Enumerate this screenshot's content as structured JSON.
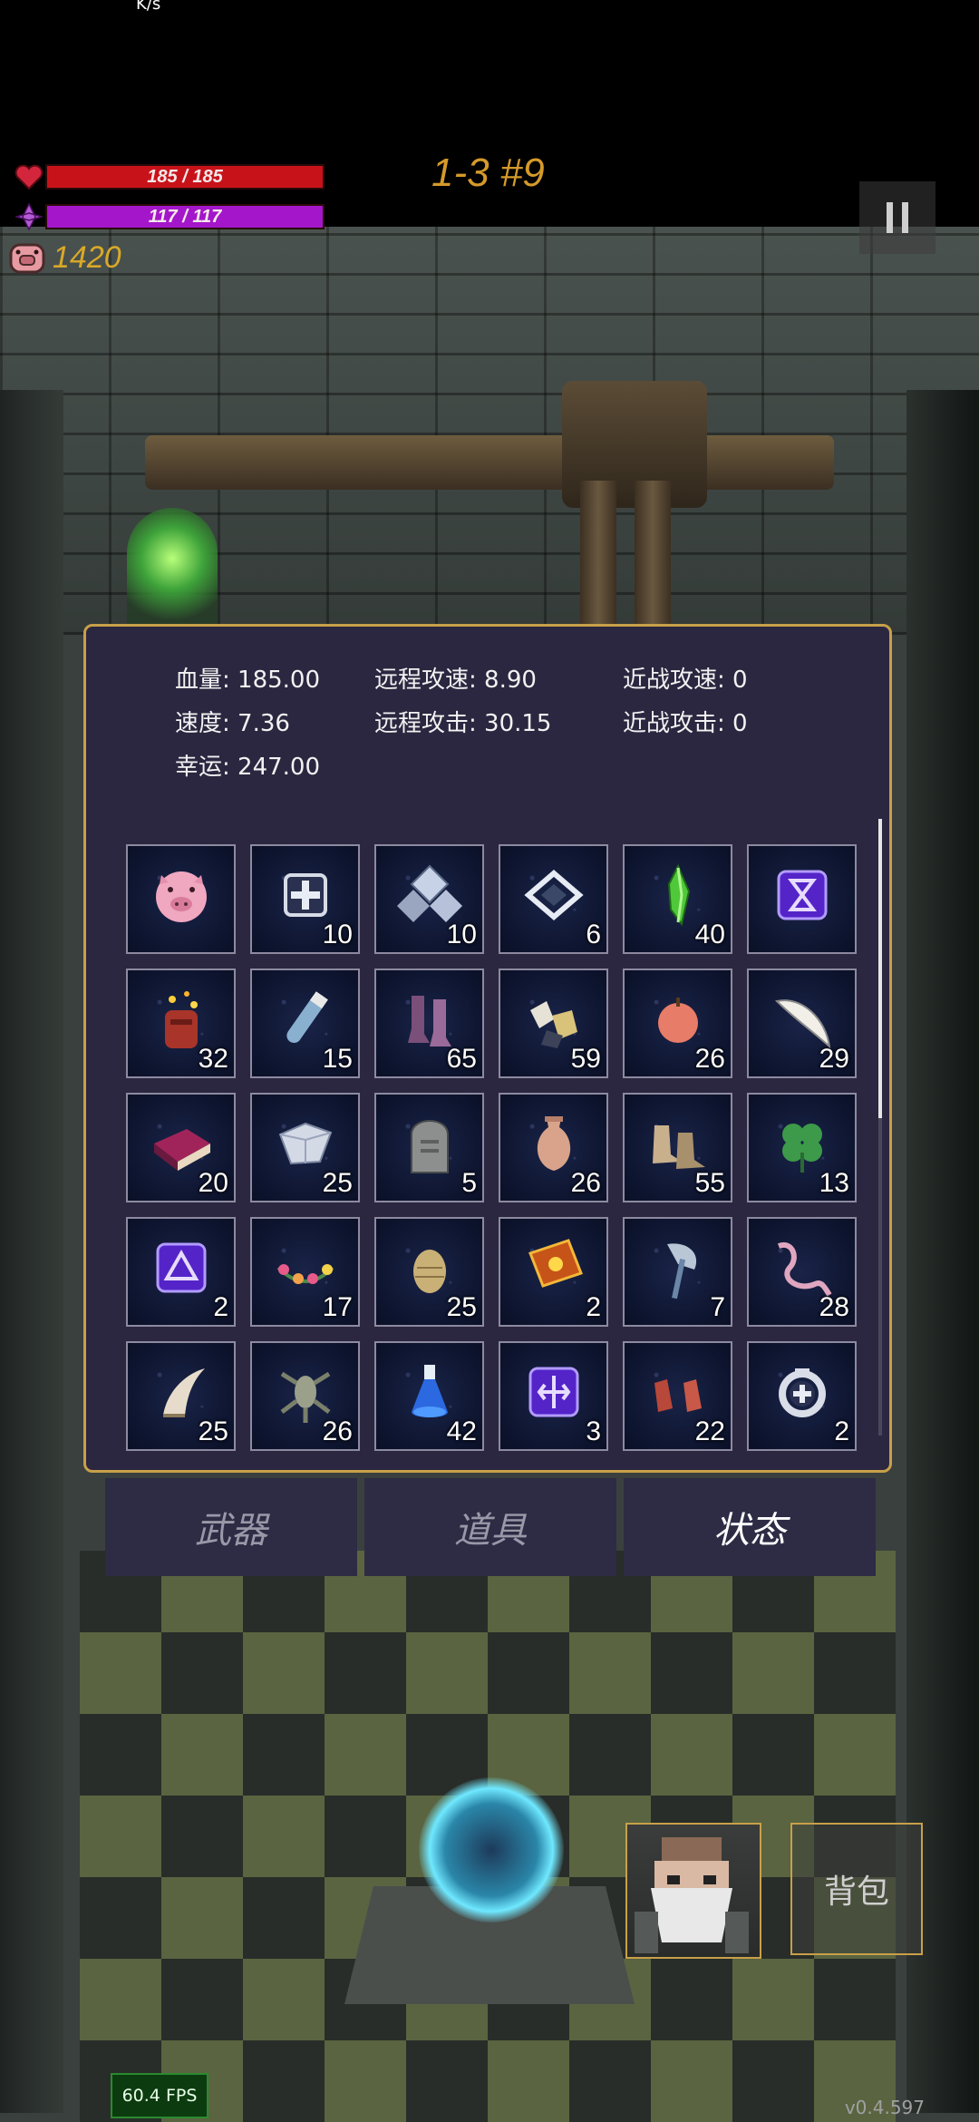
{
  "status_bar": {
    "net_speed": "K/s"
  },
  "hud": {
    "hp": {
      "text": "185 / 185",
      "fill": 1.0,
      "color": "#c8121a"
    },
    "mp": {
      "text": "117 / 117",
      "fill": 1.0,
      "color": "#a316c9"
    },
    "coins": "1420",
    "level": "1-3 #9"
  },
  "stats": {
    "hp": {
      "label": "血量:",
      "value": "185.00"
    },
    "speed": {
      "label": "速度:",
      "value": "7.36"
    },
    "luck": {
      "label": "幸运:",
      "value": "247.00"
    },
    "ranged_speed": {
      "label": "远程攻速:",
      "value": "8.90"
    },
    "ranged_attack": {
      "label": "远程攻击:",
      "value": "30.15"
    },
    "melee_speed": {
      "label": "近战攻速:",
      "value": "0"
    },
    "melee_attack": {
      "label": "近战攻击:",
      "value": "0"
    }
  },
  "items": [
    {
      "icon": "piggy-bank-icon",
      "count": ""
    },
    {
      "icon": "health-cross-rune-icon",
      "count": "10"
    },
    {
      "icon": "crystal-cluster-icon",
      "count": "10"
    },
    {
      "icon": "diamond-rune-icon",
      "count": "6"
    },
    {
      "icon": "green-crystal-icon",
      "count": "40"
    },
    {
      "icon": "hourglass-rune-icon",
      "count": ""
    },
    {
      "icon": "fire-totem-icon",
      "count": "32"
    },
    {
      "icon": "potion-vial-icon",
      "count": "15"
    },
    {
      "icon": "boots-icon",
      "count": "65"
    },
    {
      "icon": "ore-chunks-icon",
      "count": "59"
    },
    {
      "icon": "apple-icon",
      "count": "26"
    },
    {
      "icon": "feather-icon",
      "count": "29"
    },
    {
      "icon": "spellbook-icon",
      "count": "20"
    },
    {
      "icon": "silver-gem-icon",
      "count": "25"
    },
    {
      "icon": "tombstone-icon",
      "count": "5"
    },
    {
      "icon": "vase-icon",
      "count": "26"
    },
    {
      "icon": "leather-boots-icon",
      "count": "55"
    },
    {
      "icon": "four-leaf-clover-icon",
      "count": "13"
    },
    {
      "icon": "triangle-rune-icon",
      "count": "2"
    },
    {
      "icon": "flower-garland-icon",
      "count": "17"
    },
    {
      "icon": "egg-icon",
      "count": "25"
    },
    {
      "icon": "golden-tome-icon",
      "count": "2"
    },
    {
      "icon": "axe-icon",
      "count": "7"
    },
    {
      "icon": "worm-icon",
      "count": "28"
    },
    {
      "icon": "fang-icon",
      "count": "25"
    },
    {
      "icon": "lizard-icon",
      "count": "26"
    },
    {
      "icon": "blue-potion-icon",
      "count": "42"
    },
    {
      "icon": "split-rune-icon",
      "count": "3"
    },
    {
      "icon": "gloves-icon",
      "count": "22"
    },
    {
      "icon": "silver-ring-icon",
      "count": "2"
    }
  ],
  "tabs": [
    {
      "label": "武器",
      "active": false
    },
    {
      "label": "道具",
      "active": false
    },
    {
      "label": "状态",
      "active": true
    }
  ],
  "bag_label": "背包",
  "fps": "60.4 FPS",
  "version": "v0.4.597"
}
